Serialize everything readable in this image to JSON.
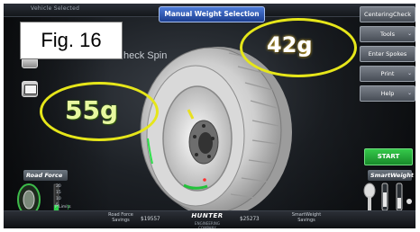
{
  "figure_label": "Fig. 16",
  "header": {
    "left_text": "Vehicle Selected",
    "title": "Manual Weight Selection"
  },
  "menu": {
    "items": [
      {
        "label": "CenteringCheck",
        "chevron": ""
      },
      {
        "label": "Tools",
        "chevron": "⌄"
      },
      {
        "label": "Enter Spokes",
        "chevron": ""
      },
      {
        "label": "Print",
        "chevron": "⌄"
      },
      {
        "label": "Help",
        "chevron": "⌄"
      }
    ],
    "start_label": "START"
  },
  "overlay": {
    "check_spin_text": "heck Spin"
  },
  "weights": {
    "left": "55g",
    "right": "42g"
  },
  "panels": {
    "road_force_label": "Road Force",
    "smart_weight_label": "SmartWeight",
    "road_force_scale": [
      "20",
      "15",
      "10",
      "5"
    ],
    "road_force_value": "7",
    "limits_label": "P Limits"
  },
  "footer": {
    "left_label": "Road Force Savings",
    "left_value": "$19557",
    "right_label": "SmartWeight Savings",
    "right_value": "$25273",
    "brand": "HUNTER",
    "brand_sub": "ENGINEERING COMPANY"
  },
  "colors": {
    "highlight_ring": "#e6e61a",
    "start_green": "#24a83a",
    "title_blue": "#2d5bc2"
  }
}
